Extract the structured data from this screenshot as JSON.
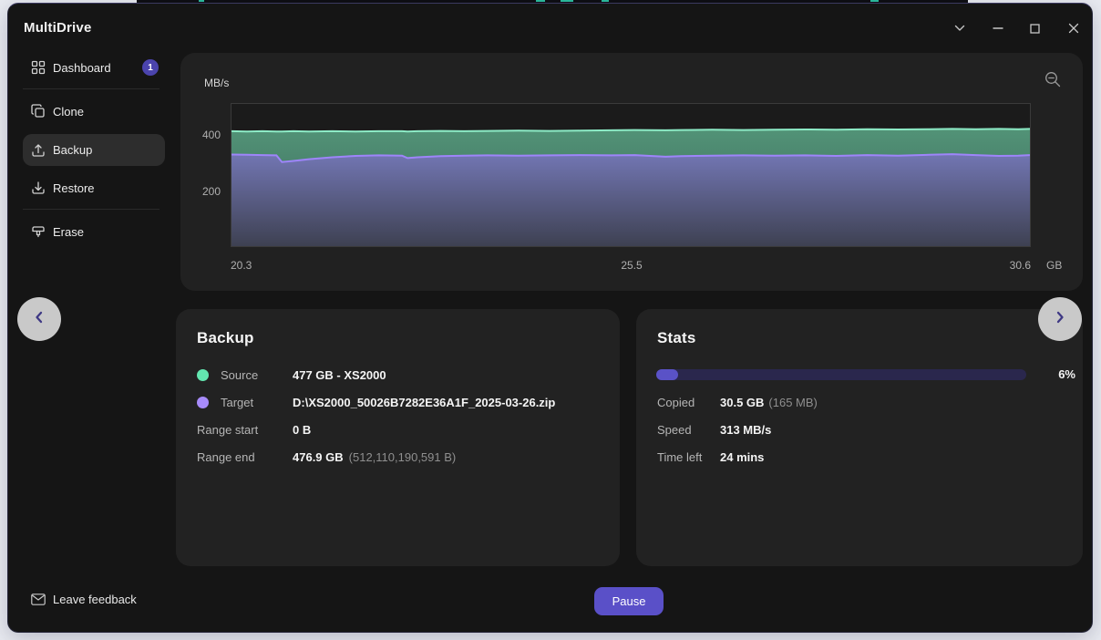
{
  "app": {
    "title": "MultiDrive"
  },
  "sidebar": {
    "items": [
      {
        "label": "Dashboard",
        "icon": "dashboard-grid-icon",
        "badge": "1",
        "selected": false
      },
      {
        "label": "Clone",
        "icon": "clone-copy-icon",
        "selected": false
      },
      {
        "label": "Backup",
        "icon": "backup-upload-icon",
        "selected": true
      },
      {
        "label": "Restore",
        "icon": "restore-download-icon",
        "selected": false
      },
      {
        "label": "Erase",
        "icon": "erase-wiper-icon",
        "selected": false
      }
    ]
  },
  "chart_data": {
    "type": "area",
    "ylabel": "MB/s",
    "xlabel": "GB",
    "ylim": [
      0,
      512
    ],
    "xlim": [
      20.3,
      30.6
    ],
    "yticks": [
      200,
      400
    ],
    "xticks": [
      20.3,
      25.5,
      30.6
    ],
    "grid": false,
    "legend": "none",
    "x": [
      20.3,
      20.5,
      20.7,
      20.88,
      20.95,
      21.1,
      21.3,
      21.6,
      21.9,
      22.2,
      22.5,
      22.57,
      22.7,
      23.0,
      23.3,
      23.6,
      24.0,
      24.4,
      24.8,
      25.2,
      25.5,
      25.9,
      26.1,
      26.5,
      26.9,
      27.3,
      27.7,
      28.1,
      28.5,
      28.9,
      29.3,
      29.6,
      29.9,
      30.2,
      30.45,
      30.6
    ],
    "series": [
      {
        "name": "source-read-speed",
        "line_color": "#8debc6",
        "fill_top": "#529377",
        "fill_bottom": "#3a6357",
        "values": [
          414,
          413,
          414,
          413,
          413,
          414,
          413,
          414,
          413,
          414,
          414,
          413,
          414,
          415,
          414,
          415,
          416,
          415,
          416,
          417,
          418,
          417,
          418,
          419,
          418,
          419,
          420,
          419,
          421,
          420,
          421,
          422,
          421,
          422,
          421,
          422
        ]
      },
      {
        "name": "target-write-speed",
        "line_color": "#9e85fa",
        "fill_top": "#7276b3",
        "fill_bottom": "#3e4152",
        "values": [
          330,
          329,
          328,
          327,
          303,
          307,
          313,
          320,
          325,
          327,
          326,
          317,
          320,
          324,
          326,
          327,
          326,
          327,
          328,
          327,
          328,
          322,
          324,
          326,
          327,
          326,
          327,
          325,
          328,
          326,
          329,
          331,
          328,
          325,
          326,
          328
        ]
      }
    ]
  },
  "backup_panel": {
    "title": "Backup",
    "source": {
      "label": "Source",
      "value": "477 GB - XS2000",
      "dot_color": "#63e6b0"
    },
    "target": {
      "label": "Target",
      "value": "D:\\XS2000_50026B7282E36A1F_2025-03-26.zip",
      "dot_color": "#a78bfa"
    },
    "range_start": {
      "label": "Range start",
      "value": "0 B"
    },
    "range_end": {
      "label": "Range end",
      "value": "476.9 GB",
      "note": "(512,110,190,591 B)"
    }
  },
  "stats_panel": {
    "title": "Stats",
    "progress_percent": 6,
    "progress_label": "6%",
    "copied": {
      "label": "Copied",
      "value": "30.5 GB",
      "note": "(165 MB)"
    },
    "speed": {
      "label": "Speed",
      "value": "313 MB/s"
    },
    "time_left": {
      "label": "Time left",
      "value": "24 mins"
    }
  },
  "footer": {
    "feedback_label": "Leave feedback",
    "pause_label": "Pause"
  },
  "colors": {
    "accent": "#5a50c8",
    "badge": "#4b44ad",
    "progress_track": "#2a274d",
    "progress_fill": "#5a52c7"
  }
}
